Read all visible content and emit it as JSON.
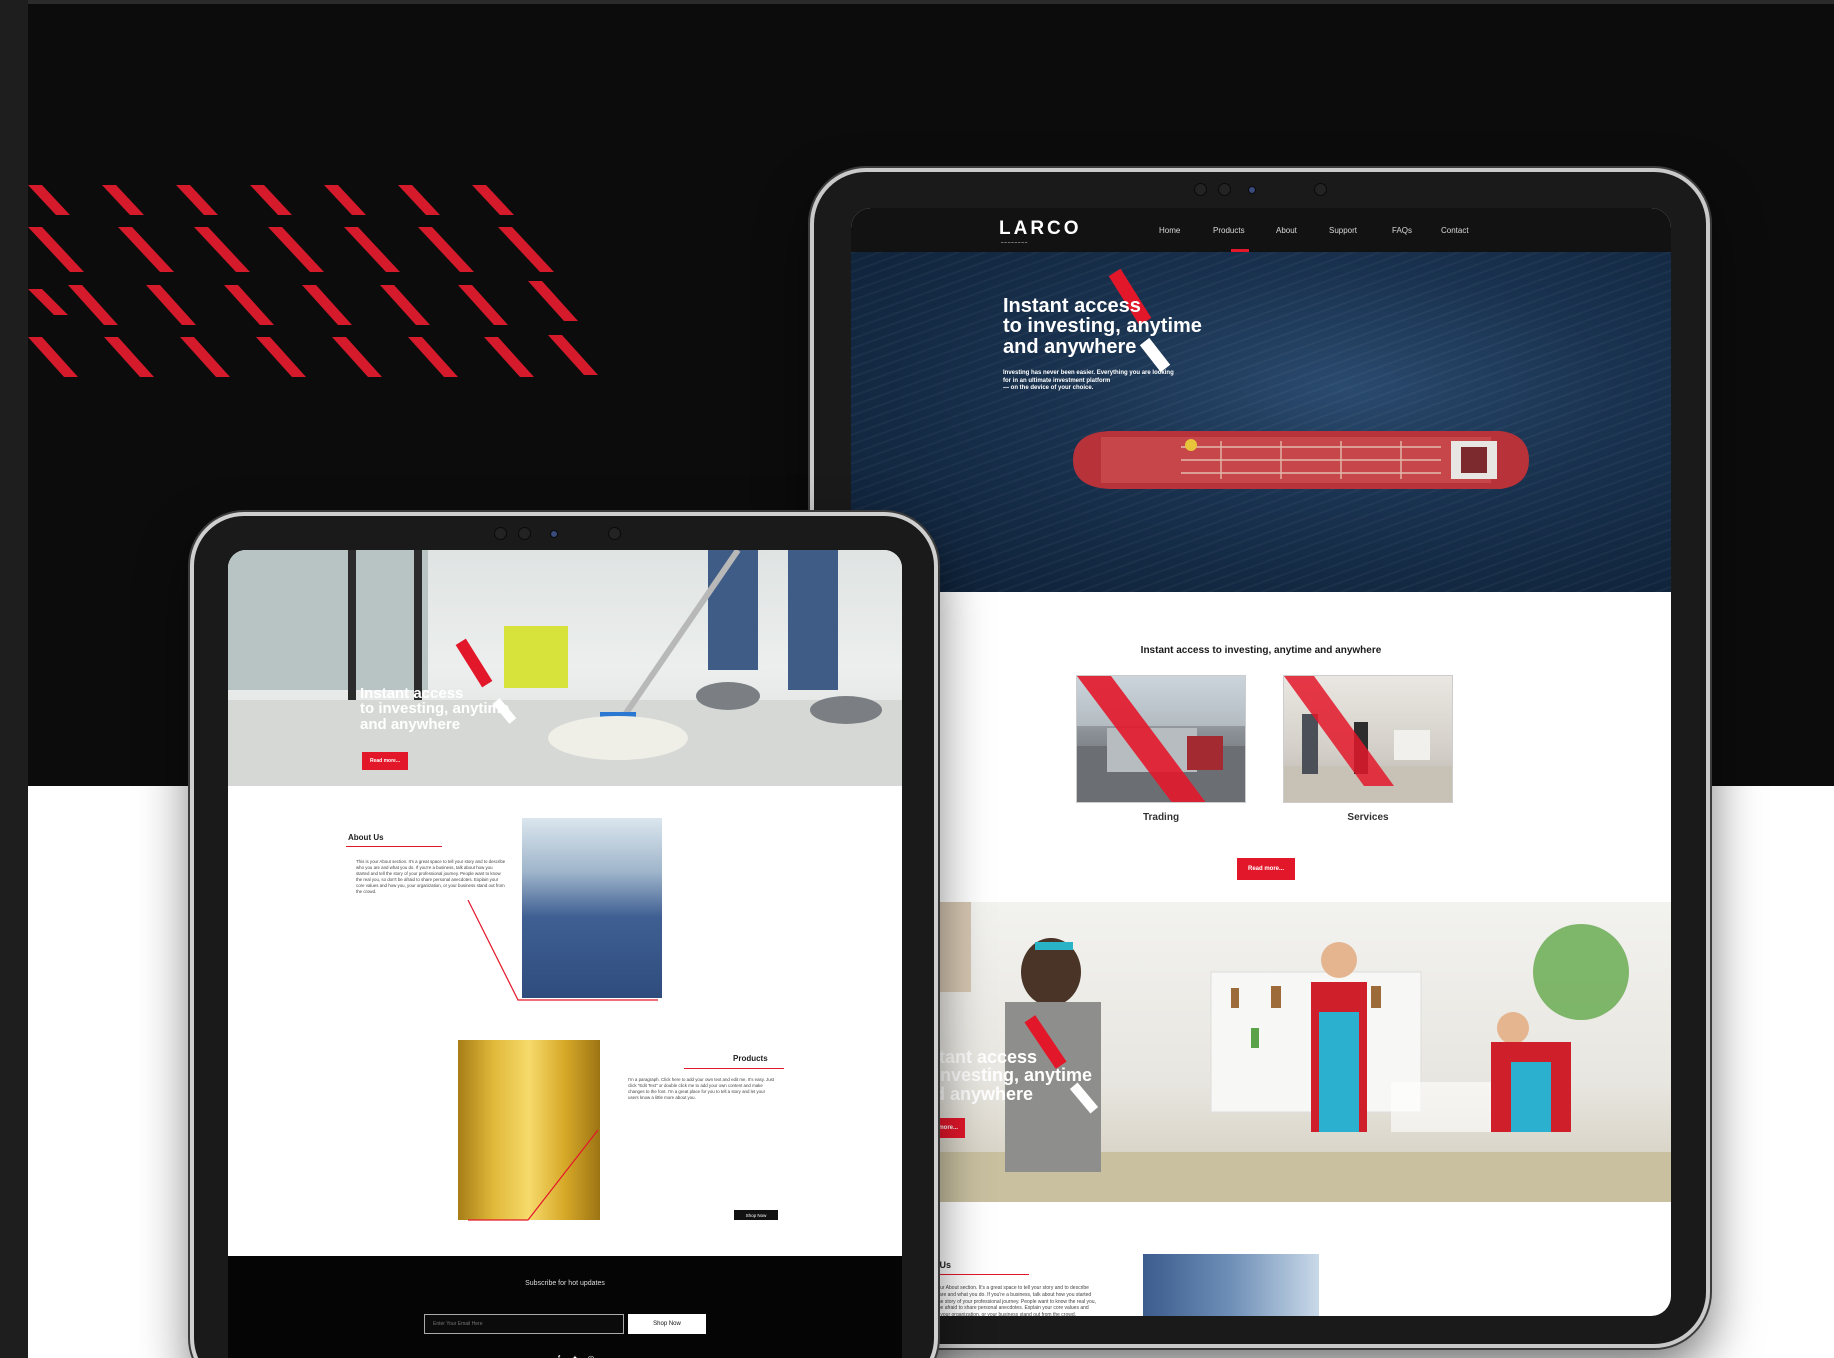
{
  "brand": {
    "name": "LARCO",
    "accent_color": "#e3172a",
    "dark_color": "#0c0c0c"
  },
  "nav": {
    "items": [
      "Home",
      "Products",
      "About",
      "Support",
      "FAQs",
      "Contact"
    ],
    "active": "Products"
  },
  "hero": {
    "title_line1": "Instant access",
    "title_line2": "to investing, anytime",
    "title_line3": "and anywhere",
    "description_line1": "Investing has never been easier. Everything you are looking",
    "description_line2": "for in an ultimate investment platform",
    "description_line3": "— on the device of your choice."
  },
  "cards_section": {
    "title": "Instant access to investing, anytime and anywhere",
    "cards": [
      {
        "label": "Trading"
      },
      {
        "label": "Services"
      }
    ],
    "button_label": "Read more..."
  },
  "promo": {
    "title_line1": "Instant access",
    "title_line2": "to investing, anytime",
    "title_line3": "and anywhere",
    "button_label": "Read more..."
  },
  "about": {
    "title": "About Us",
    "text": "This is your About section. It's a great space to tell your story and to describe who you are and what you do. If you're a business, talk about how you started and tell the story of your professional journey. People want to know the real you, so don't be afraid to share personal anecdotes. Explain your core values and how you, your organization, or your business stand out from the crowd."
  },
  "products": {
    "title": "Products",
    "text": "I'm a paragraph. Click here to add your own text and edit me. It's easy. Just click \"Edit Text\" or double click me to add your own content and make changes to the font. I'm a great place for you to tell a story and let your users know a little more about you.",
    "button_label": "Shop Now"
  },
  "left_hero": {
    "title_line1": "Instant access",
    "title_line2": "to investing, anytime",
    "title_line3": "and anywhere",
    "button_label": "Read more..."
  },
  "footer": {
    "title": "Subscribe for hot updates",
    "email_placeholder": "Enter Your Email Here",
    "submit_label": "Shop Now",
    "social_icons": [
      "facebook-icon",
      "twitter-icon",
      "instagram-icon"
    ]
  }
}
